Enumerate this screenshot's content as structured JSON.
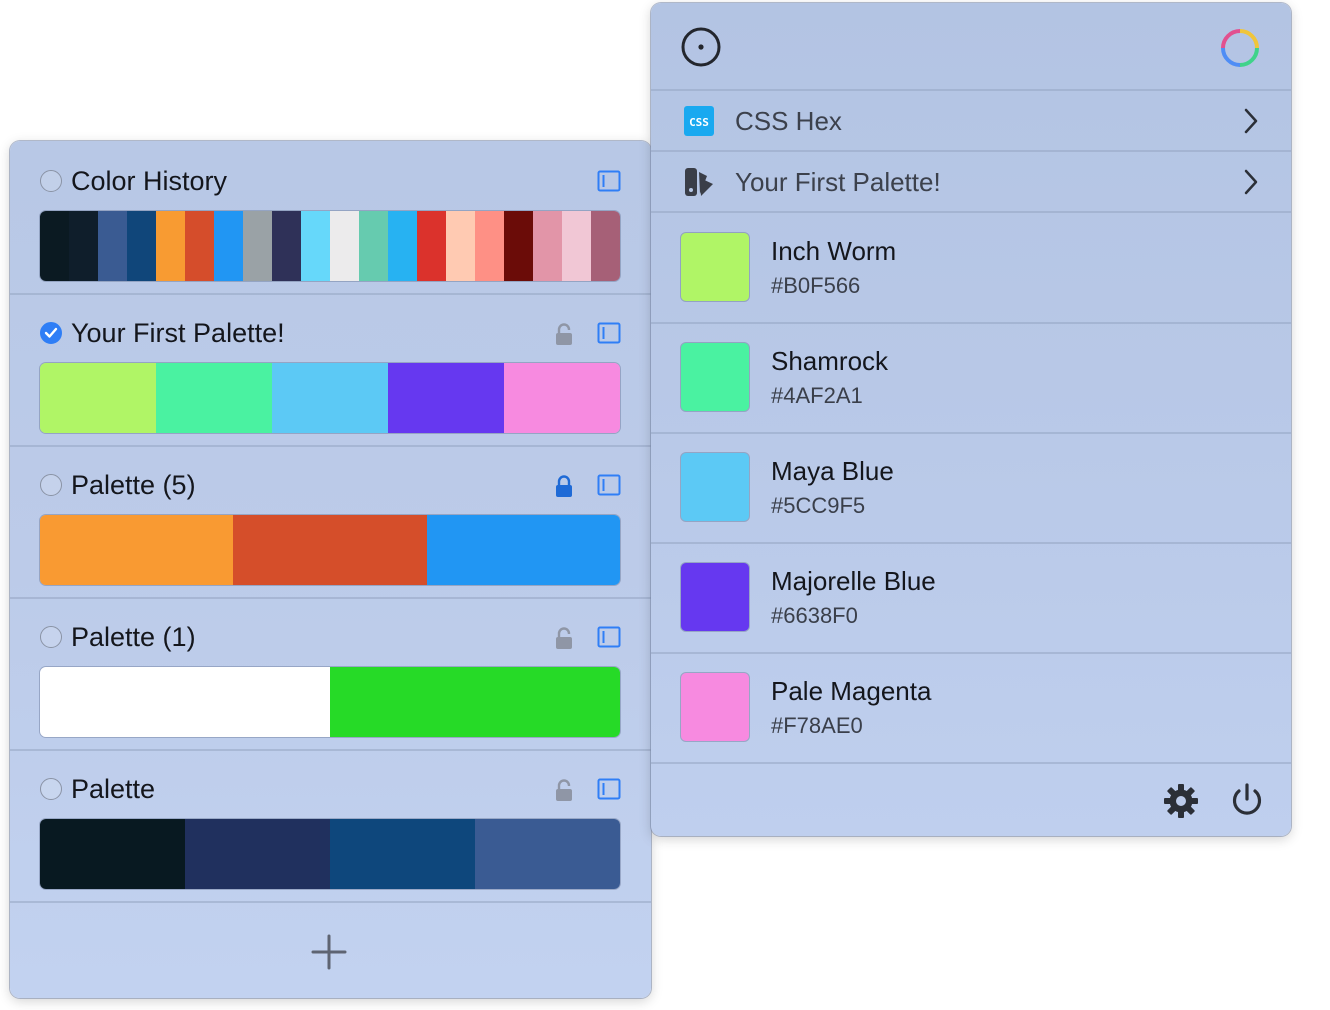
{
  "palettes_panel": {
    "sections": [
      {
        "title": "Color History",
        "selected": false,
        "has_lock": false,
        "locked": false,
        "swatches": [
          "#0b1a22",
          "#0f1e2b",
          "#3a5b92",
          "#10467a",
          "#f89b32",
          "#d54d2b",
          "#2196f3",
          "#9aa2a6",
          "#2f3158",
          "#66d8fa",
          "#ecebec",
          "#66cbaf",
          "#27b2f2",
          "#db322c",
          "#ffcab2",
          "#fe9085",
          "#6b0c08",
          "#e295a8",
          "#f1c7d5",
          "#a66077"
        ]
      },
      {
        "title": "Your First Palette!",
        "selected": true,
        "has_lock": true,
        "locked": false,
        "swatches": [
          "#B0F566",
          "#4AF2A1",
          "#5CC9F5",
          "#6638F0",
          "#F78AE0"
        ]
      },
      {
        "title": "Palette (5)",
        "selected": false,
        "has_lock": true,
        "locked": true,
        "swatches": [
          "#f99a32",
          "#d54e2a",
          "#2196f3"
        ]
      },
      {
        "title": "Palette (1)",
        "selected": false,
        "has_lock": true,
        "locked": false,
        "swatches": [
          "#ffffff",
          "#26da27"
        ]
      },
      {
        "title": "Palette",
        "selected": false,
        "has_lock": true,
        "locked": false,
        "swatches": [
          "#081921",
          "#20305e",
          "#0e477c",
          "#3a5b93"
        ]
      }
    ],
    "add_icon": "plus-icon"
  },
  "picker_panel": {
    "top_icons": [
      "color-picker-icon",
      "color-wheel-icon"
    ],
    "format_row": {
      "icon": "css-icon",
      "label": "CSS Hex"
    },
    "palette_row": {
      "icon": "swatchbook-icon",
      "label": "Your First Palette!"
    },
    "colors": [
      {
        "name": "Inch Worm",
        "hex": "#B0F566"
      },
      {
        "name": "Shamrock",
        "hex": "#4AF2A1"
      },
      {
        "name": "Maya Blue",
        "hex": "#5CC9F5"
      },
      {
        "name": "Majorelle Blue",
        "hex": "#6638F0"
      },
      {
        "name": "Pale Magenta",
        "hex": "#F78AE0"
      }
    ],
    "footer_icons": [
      "gear-icon",
      "power-icon"
    ]
  },
  "colors": {
    "accent": "#2f7ef6",
    "lock_active": "#1f6ad6",
    "lock_inactive": "#8f96a6",
    "css_badge": "#19a9f0"
  }
}
